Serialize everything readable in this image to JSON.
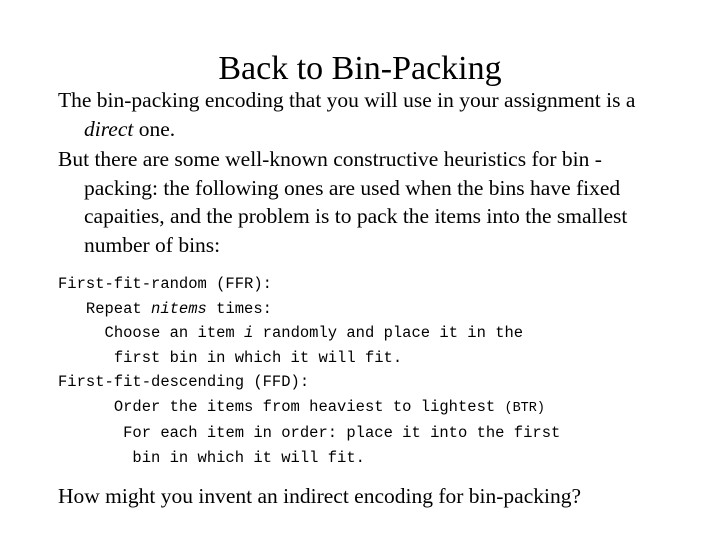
{
  "slide": {
    "title": "Back to Bin-Packing",
    "background_color": "#ffffff",
    "text_color": "#000000"
  },
  "body": {
    "paragraphs": [
      {
        "id": "para-direct-encoding",
        "prefix": "The bin-packing encoding that you will use in your assignment is a ",
        "emphasis": "direct",
        "suffix": " one."
      },
      {
        "id": "para-heuristics",
        "prefix": "But there are some well-known constructive heuristics for bin -packing: the following ones are used when the bins have fixed capaities, and the problem is to pack the items into the smallest number of bins:",
        "emphasis": "",
        "suffix": ""
      }
    ]
  },
  "code": {
    "lines": [
      {
        "id": "ffr-heading",
        "indent": 0,
        "prefix": "First-fit-random (FFR):",
        "emphasis": "",
        "suffix": "",
        "small": ""
      },
      {
        "id": "ffr-repeat",
        "indent": 3,
        "prefix": "Repeat ",
        "emphasis": "nitems",
        "suffix": " times:",
        "small": ""
      },
      {
        "id": "ffr-choose",
        "indent": 5,
        "prefix": "Choose an item ",
        "emphasis": "i",
        "suffix": " randomly and place it in the",
        "small": ""
      },
      {
        "id": "ffr-first-bin",
        "indent": 6,
        "prefix": "first bin in which it will fit.",
        "emphasis": "",
        "suffix": "",
        "small": ""
      },
      {
        "id": "ffd-heading",
        "indent": 0,
        "prefix": "First-fit-descending (FFD):",
        "emphasis": "",
        "suffix": "",
        "small": ""
      },
      {
        "id": "ffd-order",
        "indent": 6,
        "prefix": "Order the items from heaviest to lightest ",
        "emphasis": "",
        "suffix": "",
        "small": "(BTR)"
      },
      {
        "id": "ffd-foreach",
        "indent": 7,
        "prefix": "For each item in order: place it into the first",
        "emphasis": "",
        "suffix": "",
        "small": ""
      },
      {
        "id": "ffd-bin",
        "indent": 8,
        "prefix": "bin in which it will fit.",
        "emphasis": "",
        "suffix": "",
        "small": ""
      }
    ]
  },
  "closing": {
    "question": "How might you invent an indirect encoding for bin-packing?"
  }
}
